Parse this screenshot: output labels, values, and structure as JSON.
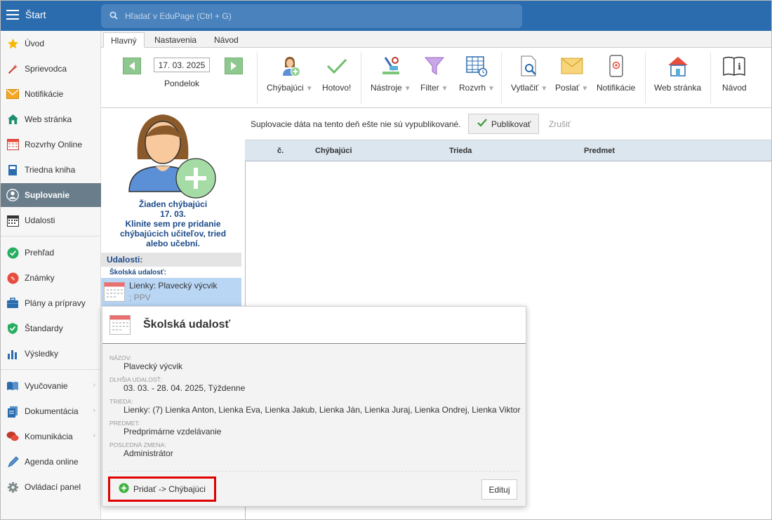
{
  "topbar": {
    "start_label": "Štart",
    "search_placeholder": "Hľadať v EduPage (Ctrl + G)"
  },
  "sidebar": {
    "items": [
      {
        "label": "Úvod",
        "icon": "star-icon"
      },
      {
        "label": "Sprievodca",
        "icon": "magic-wand-icon"
      },
      {
        "label": "Notifikácie",
        "icon": "envelope-icon"
      },
      {
        "label": "Web stránka",
        "icon": "house-icon"
      },
      {
        "label": "Rozvrhy Online",
        "icon": "timetable-icon"
      },
      {
        "label": "Triedna kniha",
        "icon": "book-icon"
      },
      {
        "label": "Suplovanie",
        "icon": "user-circle-icon"
      },
      {
        "label": "Udalosti",
        "icon": "calendar-icon"
      },
      {
        "label": "Prehľad",
        "icon": "check-circle-icon"
      },
      {
        "label": "Známky",
        "icon": "grades-icon"
      },
      {
        "label": "Plány a prípravy",
        "icon": "briefcase-icon"
      },
      {
        "label": "Štandardy",
        "icon": "shield-check-icon"
      },
      {
        "label": "Výsledky",
        "icon": "bar-chart-icon"
      },
      {
        "label": "Vyučovanie",
        "icon": "open-book-icon"
      },
      {
        "label": "Dokumentácia",
        "icon": "documents-icon"
      },
      {
        "label": "Komunikácia",
        "icon": "chat-icon"
      },
      {
        "label": "Agenda online",
        "icon": "pen-icon"
      },
      {
        "label": "Ovládací panel",
        "icon": "gear-icon"
      }
    ],
    "active": "Suplovanie"
  },
  "tabs": [
    {
      "label": "Hlavný"
    },
    {
      "label": "Nastavenia"
    },
    {
      "label": "Návod"
    }
  ],
  "ribbon": {
    "date": "17. 03. 2025",
    "day": "Pondelok",
    "buttons": {
      "absent": "Chýbajúci",
      "done": "Hotovo!",
      "tools": "Nástroje",
      "filter": "Filter",
      "timetable": "Rozvrh",
      "print": "Vytlačiť",
      "send": "Poslať",
      "notifications": "Notifikácie",
      "website": "Web stránka",
      "guide": "Návod"
    }
  },
  "left_panel": {
    "nobody_line1": "Žiaden chýbajúci",
    "nobody_line2": "17. 03.",
    "nobody_line3": "Klinite sem pre pridanie",
    "nobody_line4": "chýbajúcich učiteľov, tried",
    "nobody_line5": "alebo učební.",
    "events_header": "Udalosti:",
    "events_sub": "Školská udalosť:",
    "event_title": "Lienky: Plavecký výcvik",
    "event_sub": "; PPV"
  },
  "main": {
    "notice": "Suplovacie dáta na tento deň ešte nie sú vypublikované.",
    "publish": "Publikovať",
    "cancel": "Zrušiť",
    "columns": [
      "č.",
      "Chýbajúci",
      "Trieda",
      "Predmet"
    ]
  },
  "popup": {
    "title": "Školská udalosť",
    "fields": [
      {
        "label": "NÁZOV:",
        "value": "Plavecký výcvik"
      },
      {
        "label": "DLHŠIA UDALOSŤ:",
        "value": "03. 03. - 28. 04. 2025, Týždenne"
      },
      {
        "label": "TRIEDA:",
        "value": "Lienky: (7) Lienka Anton, Lienka Eva, Lienka Jakub, Lienka Ján, Lienka Juraj, Lienka Ondrej, Lienka Viktor"
      },
      {
        "label": "PREDMET:",
        "value": "Predprimárne vzdelávanie"
      },
      {
        "label": "POSLEDNÁ ZMENA:",
        "value": "Administrátor"
      }
    ],
    "add_button": "Pridať -> Chýbajúci",
    "edit_button": "Edituj"
  },
  "colors": {
    "topbar": "#2a6cad",
    "sidebar_active": "#6a7d8a",
    "highlight_border": "#e00000",
    "event_bg": "#b9d6f5"
  }
}
